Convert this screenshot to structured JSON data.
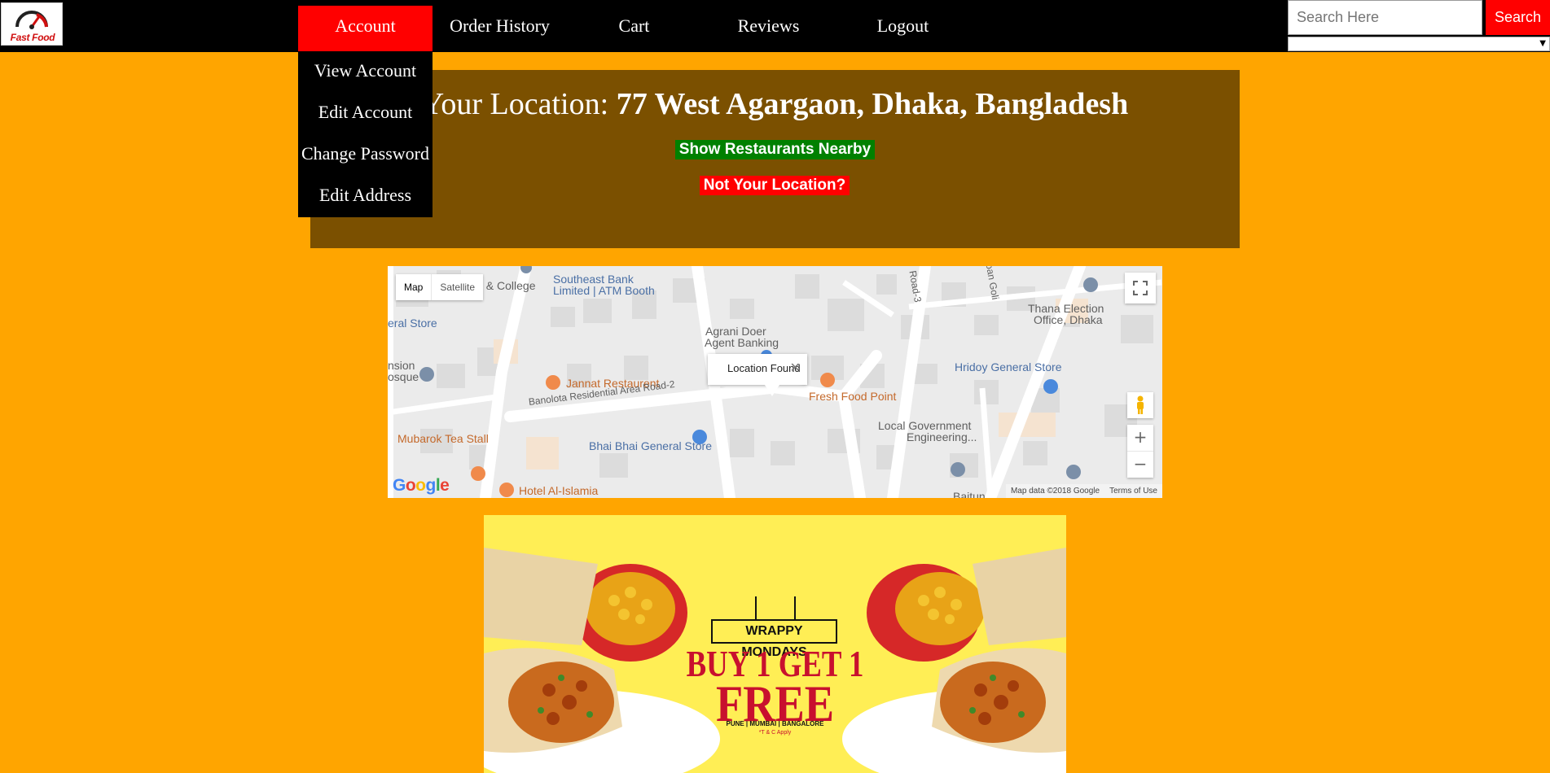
{
  "brand": {
    "logo_text": "Fast Food"
  },
  "nav": {
    "account": "Account",
    "order_history": "Order History",
    "cart": "Cart",
    "reviews": "Reviews",
    "logout": "Logout"
  },
  "search": {
    "placeholder": "Search Here",
    "button": "Search",
    "select_value": ""
  },
  "account_menu": {
    "view": "View Account",
    "edit": "Edit Account",
    "password": "Change Password",
    "address": "Edit Address"
  },
  "location": {
    "prefix": "Your Location: ",
    "address": "77 West Agargaon, Dhaka, Bangladesh",
    "nearby_button": "Show Restaurants Nearby",
    "not_location_button": "Not Your Location?"
  },
  "map": {
    "type_map": "Map",
    "type_satellite": "Satellite",
    "infowindow": "Location Found",
    "zoom_in": "+",
    "zoom_out": "−",
    "attribution": "Map data ©2018 Google",
    "terms": "Terms of Use",
    "labels": {
      "school": "ol & College",
      "bank": "Southeast Bank",
      "bank2": "Limited | ATM Booth",
      "road3": "Road-3",
      "goli": "oan Goli",
      "thana": "Thana Election",
      "thana2": "Office, Dhaka",
      "store_left": "eral Store",
      "agrani": "Agrani Doer",
      "agrani2": "Agent Banking",
      "mosque": "nsion",
      "mosque2": "osque",
      "jannat": "Jannat Restaurent",
      "freshfood": "Fresh Food Point",
      "hridoy": "Hridoy General Store",
      "road2": "Banolota Residential Area Road-2",
      "local_gov": "Local Government",
      "local_gov2": "Engineering...",
      "mubarok": "Mubarok Tea Stall",
      "bhai": "Bhai Bhai General Store",
      "islamia": "Hotel Al-Islamia",
      "baitun": "Baitun"
    }
  },
  "promo": {
    "tag": "WRAPPY MONDAYS",
    "headline": "BUY 1 GET 1",
    "free": "FREE",
    "cities": "PUNE | MUMBAI | BANGALORE",
    "tc": "*T & C Apply"
  },
  "colors": {
    "page_bg": "#FFA500",
    "nav_bg": "#000000",
    "accent_red": "#FF0000",
    "panel_bg": "#7B5000",
    "green": "#008000"
  }
}
